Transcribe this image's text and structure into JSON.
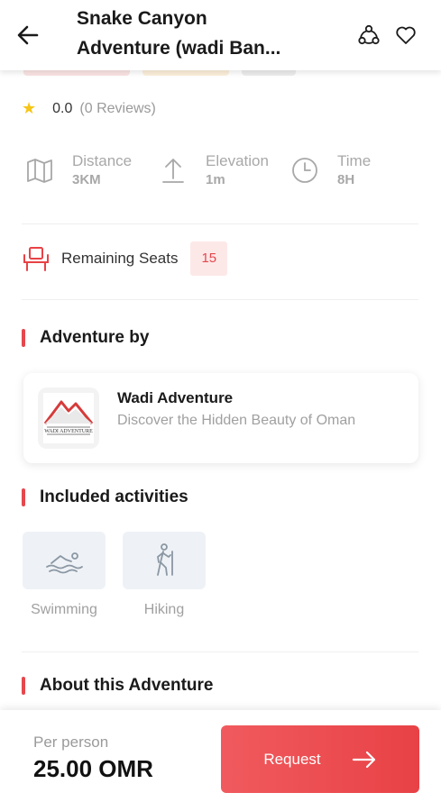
{
  "header": {
    "title_line1": "Snake Canyon",
    "title_line2": "Adventure (wadi Ban..."
  },
  "rating": {
    "value": "0.0",
    "reviews": "(0 Reviews)"
  },
  "stats": [
    {
      "label": "Distance",
      "value": "3KM",
      "icon": "map-icon"
    },
    {
      "label": "Elevation",
      "value": "1m",
      "icon": "arrow-up-icon"
    },
    {
      "label": "Time",
      "value": "8H",
      "icon": "clock-icon"
    }
  ],
  "seats": {
    "label": "Remaining Seats",
    "count": "15"
  },
  "sections": {
    "adventure_by": "Adventure by",
    "included_activities": "Included activities",
    "about": "About this Adventure"
  },
  "provider": {
    "name": "Wadi Adventure",
    "tagline": "Discover the Hidden Beauty of Oman",
    "logo_text": "WADI ADVENTURE"
  },
  "activities": [
    {
      "name": "Swimming",
      "icon": "swimming-icon"
    },
    {
      "name": "Hiking",
      "icon": "hiking-icon"
    }
  ],
  "booking": {
    "per_person_label": "Per person",
    "price": "25.00 OMR",
    "request_label": "Request"
  },
  "colors": {
    "accent": "#e84246",
    "badge_bg": "#fde8e8",
    "tile_bg": "#eef2f6"
  }
}
